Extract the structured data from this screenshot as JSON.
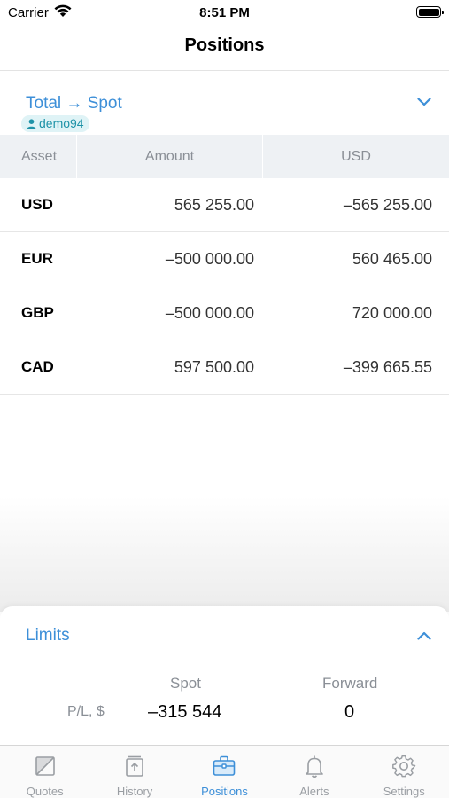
{
  "status_bar": {
    "carrier": "Carrier",
    "time": "8:51 PM"
  },
  "nav": {
    "title": "Positions"
  },
  "section": {
    "title": "Total → Spot",
    "account": "demo94"
  },
  "table": {
    "headers": [
      "Asset",
      "Amount",
      "USD"
    ],
    "rows": [
      {
        "asset": "USD",
        "amount": "565 255.00",
        "usd": "–565 255.00"
      },
      {
        "asset": "EUR",
        "amount": "–500 000.00",
        "usd": "560 465.00"
      },
      {
        "asset": "GBP",
        "amount": "–500 000.00",
        "usd": "720 000.00"
      },
      {
        "asset": "CAD",
        "amount": "597 500.00",
        "usd": "–399 665.55"
      }
    ]
  },
  "limits": {
    "title": "Limits",
    "columns": [
      "Spot",
      "Forward"
    ],
    "row_label": "P/L, $",
    "spot_value": "–315 544",
    "forward_value": "0"
  },
  "tabs": [
    {
      "label": "Quotes",
      "icon": "quotes-icon",
      "active": false
    },
    {
      "label": "History",
      "icon": "history-icon",
      "active": false
    },
    {
      "label": "Positions",
      "icon": "positions-icon",
      "active": true
    },
    {
      "label": "Alerts",
      "icon": "bell-icon",
      "active": false
    },
    {
      "label": "Settings",
      "icon": "gear-icon",
      "active": false
    }
  ],
  "colors": {
    "accent": "#3d8fd8",
    "badge_bg": "#dff3f6",
    "badge_text": "#1f93a8",
    "header_bg": "#eef1f4",
    "muted": "#8a8f96"
  }
}
